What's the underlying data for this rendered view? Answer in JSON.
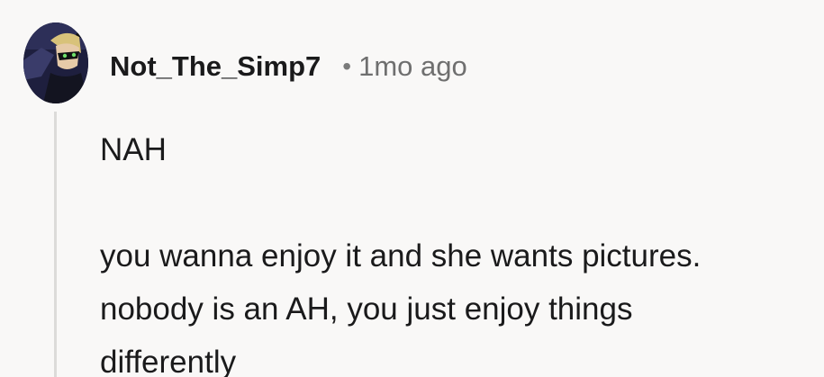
{
  "comment": {
    "username": "Not_The_Simp7",
    "separator": "•",
    "time_ago": "1mo ago",
    "body_lines": [
      "NAH",
      "you wanna enjoy it and she wants pictures.",
      "nobody is an AH, you just enjoy things",
      "differently"
    ]
  },
  "colors": {
    "background": "#f9f8f7",
    "username": "#1a1a1b",
    "meta": "#6f6f6f",
    "thread_line": "#dcdbd9"
  },
  "icons": {
    "avatar": "user-avatar-image"
  }
}
